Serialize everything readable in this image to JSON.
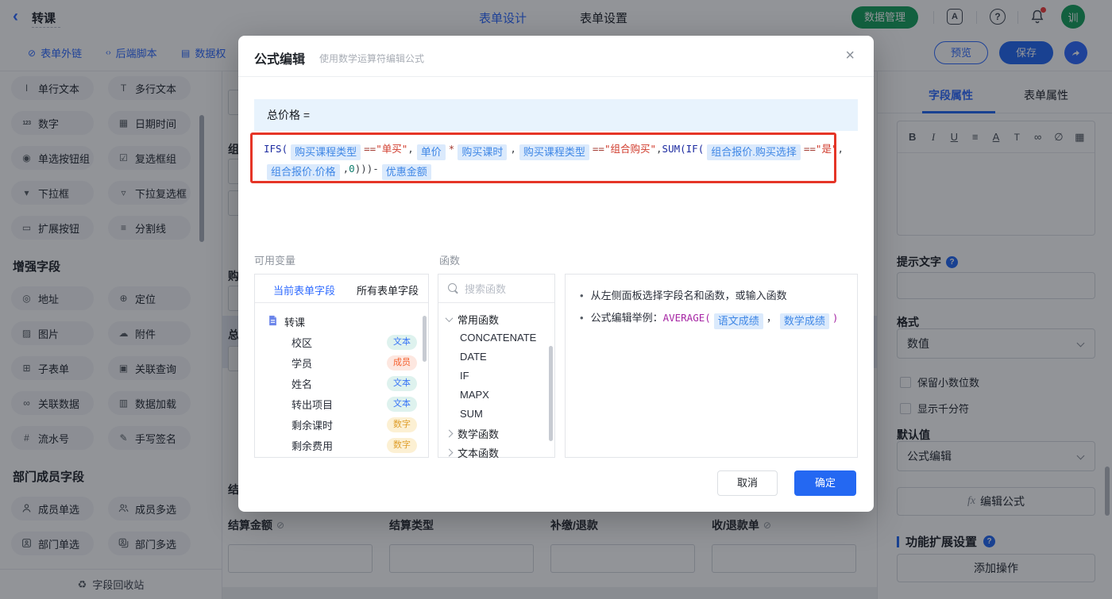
{
  "topbar": {
    "title": "转课",
    "tabs": [
      {
        "label": "表单设计",
        "active": true
      },
      {
        "label": "表单设置",
        "active": false
      }
    ],
    "data_manage_label": "数据管理",
    "avatar_text": "训",
    "icons": [
      "back-icon",
      "language-doc-icon",
      "help-icon",
      "bell-icon",
      "notification-dot"
    ]
  },
  "toolbar": {
    "links": [
      {
        "label": "表单外链",
        "icon": "external-link-icon"
      },
      {
        "label": "后端脚本",
        "icon": "script-icon"
      },
      {
        "label": "数据权",
        "icon": "data-permission-icon"
      }
    ],
    "preview_label": "预览",
    "save_label": "保存",
    "share_icon": "share-icon"
  },
  "sidebar": {
    "groups": [
      {
        "header": "",
        "items": [
          {
            "label": "单行文本",
            "icon": "text-icon"
          },
          {
            "label": "多行文本",
            "icon": "textarea-icon"
          },
          {
            "label": "数字",
            "icon": "number-icon"
          },
          {
            "label": "日期时间",
            "icon": "datetime-icon"
          },
          {
            "label": "单选按钮组",
            "icon": "radio-icon"
          },
          {
            "label": "复选框组",
            "icon": "checkbox-icon"
          },
          {
            "label": "下拉框",
            "icon": "select-icon"
          },
          {
            "label": "下拉复选框",
            "icon": "multiselect-icon"
          },
          {
            "label": "扩展按钮",
            "icon": "button-icon"
          },
          {
            "label": "分割线",
            "icon": "divider-icon"
          }
        ]
      },
      {
        "header": "增强字段",
        "items": [
          {
            "label": "地址",
            "icon": "address-icon"
          },
          {
            "label": "定位",
            "icon": "location-icon"
          },
          {
            "label": "图片",
            "icon": "image-icon"
          },
          {
            "label": "附件",
            "icon": "attachment-icon"
          },
          {
            "label": "子表单",
            "icon": "subform-icon"
          },
          {
            "label": "关联查询",
            "icon": "lookup-icon"
          },
          {
            "label": "关联数据",
            "icon": "relation-icon"
          },
          {
            "label": "数据加载",
            "icon": "dataload-icon"
          },
          {
            "label": "流水号",
            "icon": "serial-icon"
          },
          {
            "label": "手写签名",
            "icon": "signature-icon"
          }
        ]
      },
      {
        "header": "部门成员字段",
        "items": [
          {
            "label": "成员单选",
            "icon": "member-icon"
          },
          {
            "label": "成员多选",
            "icon": "members-icon"
          },
          {
            "label": "部门单选",
            "icon": "dept-icon"
          },
          {
            "label": "部门多选",
            "icon": "depts-icon"
          }
        ]
      }
    ],
    "recycle_label": "字段回收站",
    "recycle_icon": "recycle-icon"
  },
  "canvas": {
    "partial_labels": [
      "组",
      "购",
      "总",
      "结"
    ],
    "bottom_fields": [
      {
        "label": "结算金额",
        "hidden_icon": true
      },
      {
        "label": "结算类型",
        "hidden_icon": false
      },
      {
        "label": "补缴/退款",
        "hidden_icon": false
      },
      {
        "label": "收/退款单",
        "hidden_icon": true
      }
    ]
  },
  "modal": {
    "title": "公式编辑",
    "subtitle": "使用数学运算符编辑公式",
    "close_icon": "close-icon",
    "formula": {
      "target": "总价格 =",
      "lines": [
        [
          [
            "fn",
            "IFS("
          ],
          [
            "field",
            "购买课程类型"
          ],
          [
            "op",
            "=="
          ],
          [
            "str",
            "\"单买\""
          ],
          [
            "plain",
            ","
          ],
          [
            "field",
            "单价"
          ],
          [
            "op",
            "*"
          ],
          [
            "field",
            "购买课时"
          ],
          [
            "plain",
            ","
          ],
          [
            "field",
            "购买课程类型"
          ],
          [
            "op",
            "=="
          ],
          [
            "str",
            "\"组合购买\""
          ],
          [
            "plain",
            ","
          ],
          [
            "fn",
            "SUM("
          ],
          [
            "fn",
            "IF("
          ],
          [
            "field",
            "组合报价.购买选择"
          ],
          [
            "op",
            "=="
          ],
          [
            "str",
            "\"是\""
          ],
          [
            "plain",
            ","
          ]
        ],
        [
          [
            "field",
            "组合报价.价格"
          ],
          [
            "plain",
            ","
          ],
          [
            "num",
            "0"
          ],
          [
            "plain",
            ")))-"
          ],
          [
            "field",
            "优惠金额"
          ]
        ]
      ]
    },
    "variables": {
      "label": "可用变量",
      "tabs": [
        {
          "label": "当前表单字段",
          "active": true
        },
        {
          "label": "所有表单字段",
          "active": false
        }
      ],
      "form_name": "转课",
      "form_icon": "form-doc-icon",
      "fields": [
        {
          "name": "校区",
          "type": "文本"
        },
        {
          "name": "学员",
          "type": "成员"
        },
        {
          "name": "姓名",
          "type": "文本"
        },
        {
          "name": "转出项目",
          "type": "文本"
        },
        {
          "name": "剩余课时",
          "type": "数字"
        },
        {
          "name": "剩余费用",
          "type": "数字"
        }
      ]
    },
    "functions": {
      "label": "函数",
      "search_placeholder": "搜索函数",
      "search_icon": "search-icon",
      "groups": [
        {
          "name": "常用函数",
          "expanded": true,
          "items": [
            "CONCATENATE",
            "DATE",
            "IF",
            "MAPX",
            "SUM"
          ]
        },
        {
          "name": "数学函数",
          "expanded": false,
          "items": []
        },
        {
          "name": "文本函数",
          "expanded": false,
          "items": []
        }
      ]
    },
    "tips": {
      "line1": "从左侧面板选择字段名和函数，或输入函数",
      "line2_prefix": "公式编辑举例：",
      "line2_fn": "AVERAGE(",
      "line2_fields": [
        "语文成绩",
        "数学成绩"
      ],
      "line2_separator": "，",
      "line2_close": ")"
    },
    "cancel_label": "取消",
    "ok_label": "确定"
  },
  "right_panel": {
    "tabs": [
      {
        "label": "字段属性",
        "active": true
      },
      {
        "label": "表单属性",
        "active": false
      }
    ],
    "toolbar_icons": [
      "bold-icon",
      "italic-icon",
      "underline-icon",
      "align-icon",
      "font-color-icon",
      "font-size-icon",
      "link-icon",
      "unlink-icon",
      "picture-icon"
    ],
    "hint_label": "提示文字",
    "hint_value": "",
    "format_label": "格式",
    "format_value": "数值",
    "checkboxes": [
      {
        "label": "保留小数位数",
        "checked": false
      },
      {
        "label": "显示千分符",
        "checked": false
      }
    ],
    "default_label": "默认值",
    "default_value": "公式编辑",
    "fx_prefix": "fx",
    "fx_label": "编辑公式",
    "ext_label": "功能扩展设置",
    "add_label": "添加操作"
  },
  "colors": {
    "accent_blue": "#2f6bff",
    "primary_button": "#2468f2",
    "brand_green": "#17a05e",
    "annotation_red": "#e53527",
    "chip_bg": "#dbeafc",
    "chip_fg": "#3f87e6",
    "strip_bg": "#e8f3fd",
    "badge_colors": {
      "文本": {
        "bg": "#def2ee",
        "fg": "#3975f6"
      },
      "成员": {
        "bg": "#fde7e0",
        "fg": "#f4602f"
      },
      "数字": {
        "bg": "#fcf0d3",
        "fg": "#df9f2c"
      }
    }
  }
}
